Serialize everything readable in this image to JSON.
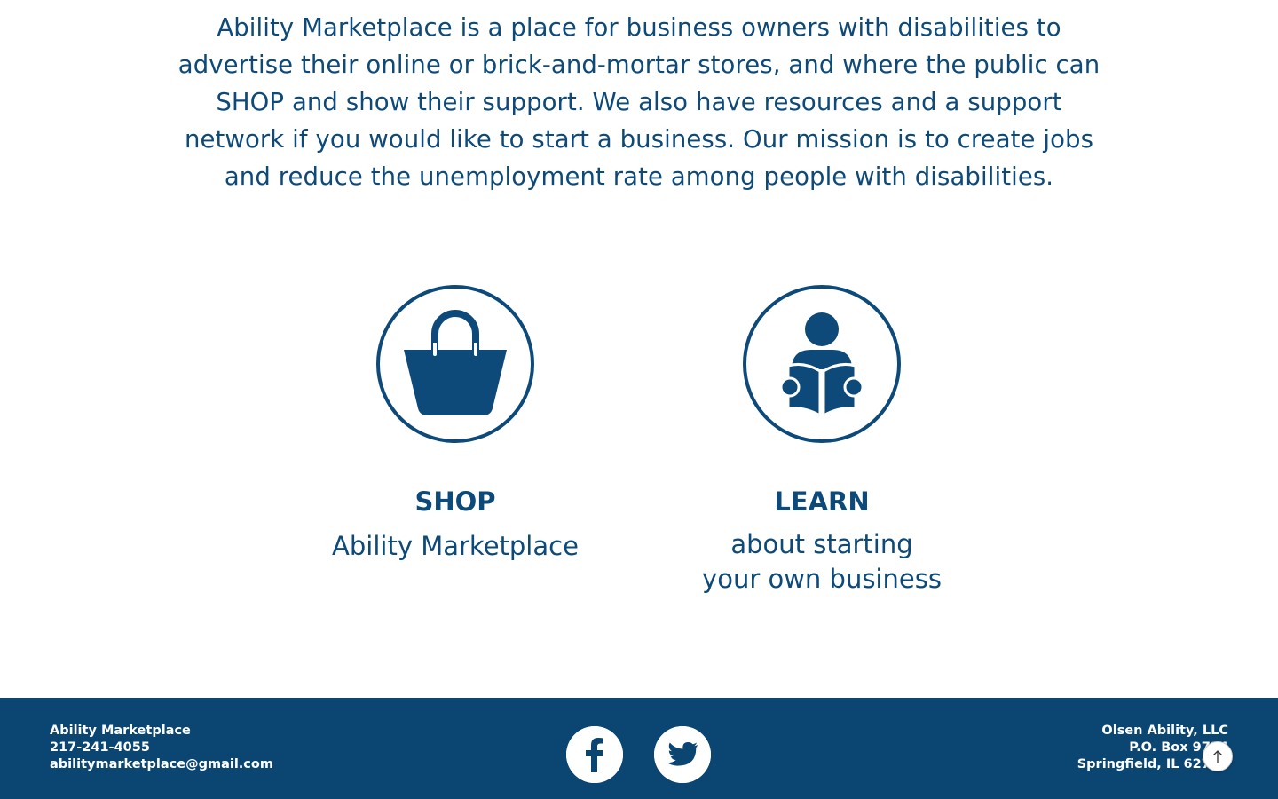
{
  "mission": {
    "text": "Ability Marketplace is a place for business owners with disabilities to advertise their online or brick-and-mortar stores, and where the public can SHOP and show their support. We also have resources and a support network if you would like to start a business. Our mission is to create jobs and reduce the unemployment rate among people with disabilities."
  },
  "cards": {
    "shop": {
      "icon": "shopping-bag-icon",
      "title": "SHOP",
      "subtitle": "Ability Marketplace"
    },
    "learn": {
      "icon": "reading-person-icon",
      "title": "LEARN",
      "subtitle_line1": "about starting",
      "subtitle_line2": "your own business"
    }
  },
  "footer": {
    "left": {
      "name": "Ability Marketplace",
      "phone": "217-241-4055",
      "email": "abilitymarketplace@gmail.com"
    },
    "right": {
      "company": "Olsen Ability, LLC",
      "po_box": "P.O. Box 9734",
      "city": "Springfield, IL 62791"
    },
    "social": [
      "facebook-icon",
      "twitter-icon"
    ]
  },
  "colors": {
    "brand": "#0d4a7a",
    "footer_bg": "#0b4673",
    "footer_text": "#ffffff"
  }
}
